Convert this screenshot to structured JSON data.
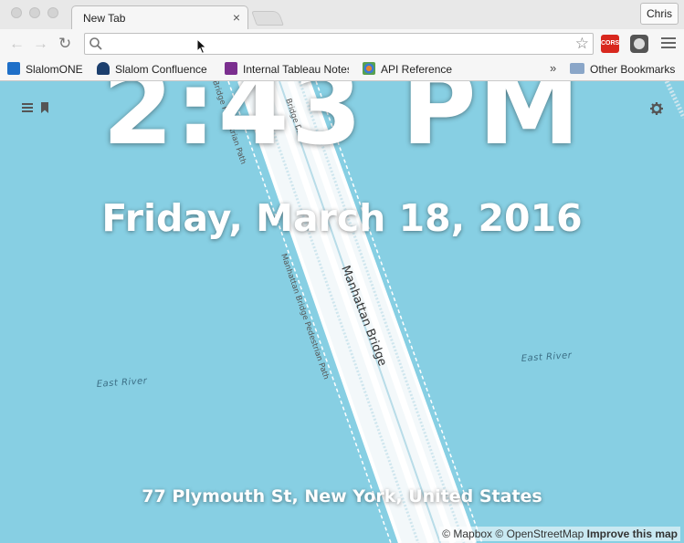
{
  "browser": {
    "tab_title": "New Tab",
    "tab_close": "×",
    "profile_name": "Chris",
    "star_glyph": "☆",
    "back_glyph": "←",
    "forward_glyph": "→",
    "reload_glyph": "↻",
    "cors_label": "CORS",
    "bookmarks": [
      {
        "label": "SlalomONE",
        "icon": "sharepoint-icon",
        "color": "#1e6fc8"
      },
      {
        "label": "Slalom Confluence",
        "icon": "confluence-icon",
        "color": "#1c3f6e"
      },
      {
        "label": "Internal Tableau Notes",
        "icon": "onenote-icon",
        "color": "#7b2f8f"
      },
      {
        "label": "API Reference",
        "icon": "tableau-icon",
        "color": "#e5832f"
      }
    ],
    "overflow_glyph": "»",
    "other_bookmarks": "Other Bookmarks"
  },
  "page": {
    "time": "2:43 PM",
    "date": "Friday, March 18, 2016",
    "address": "77 Plymouth St, New York, United States",
    "menu_icon": "hamburger-icon",
    "bookmark_icon": "bookmark-icon",
    "settings_icon": "gear-icon"
  },
  "map": {
    "labels": {
      "bridge": "Manhattan Bridge",
      "ped_path": "Manhattan Bridge Pedestrian Path",
      "ped_path_top": "Bridge Pedestrian Path",
      "bike_path": "Bridge Bike",
      "east_river_left": "East River",
      "east_river_right": "East River"
    },
    "colors": {
      "water": "#87cfe3",
      "bridge": "#ffffff"
    }
  },
  "attribution": {
    "mapbox": "© Mapbox",
    "osm": "© OpenStreetMap",
    "improve": "Improve this map"
  }
}
